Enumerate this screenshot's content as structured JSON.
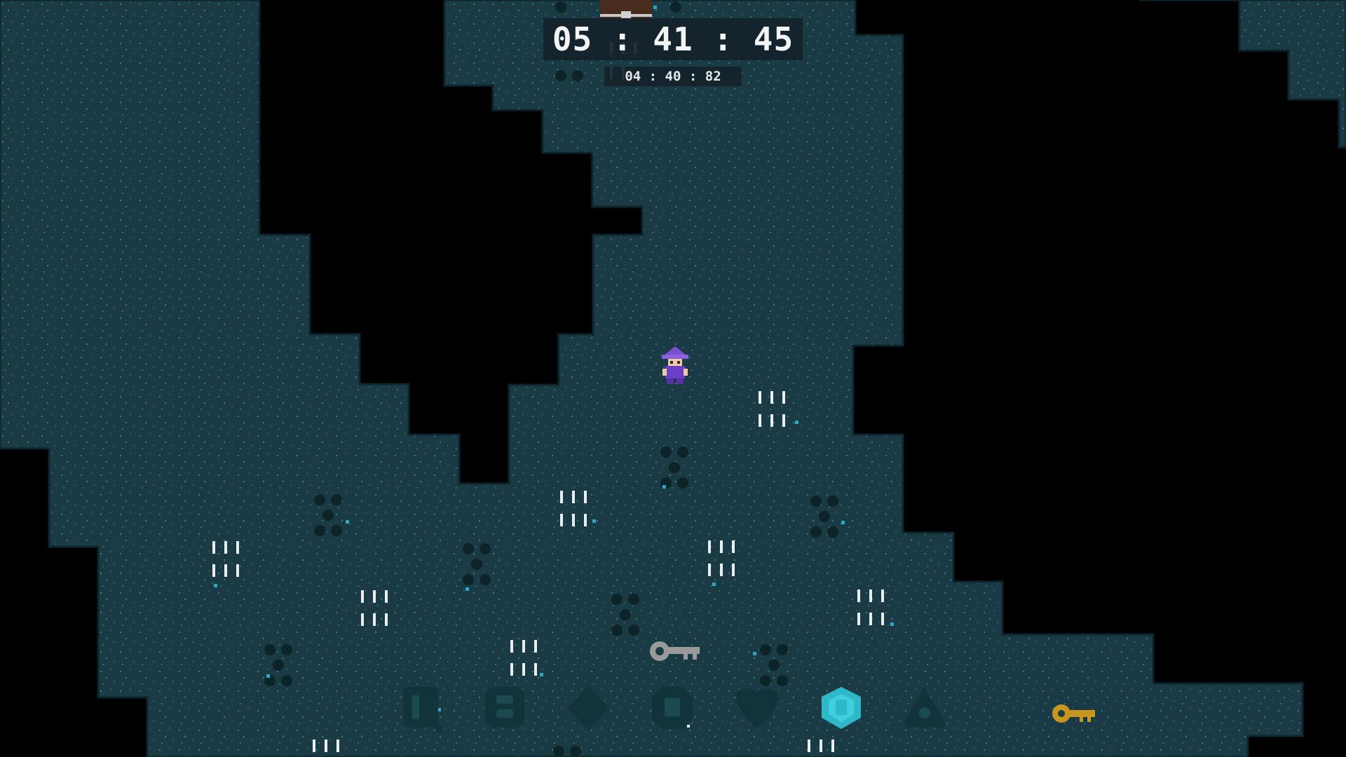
{
  "hud": {
    "current_time": "05 : 41 : 45",
    "best_time": "04 : 40 : 82"
  },
  "colors": {
    "void": "#000000",
    "floor": "#1a3a44",
    "floor_speck": "#2f7f8c",
    "player_hat": "#7a4fd0",
    "silver_key": "#9a9a9a",
    "gold_key": "#c8961e",
    "active_gem": "#2fb8c8",
    "inactive_gem": "#10343a"
  },
  "entities": {
    "player": "wizard-player",
    "chest": "treasure-chest",
    "keys": [
      "silver-key",
      "gold-key"
    ]
  },
  "inventory": {
    "slots": [
      {
        "name": "rune-d",
        "active": false
      },
      {
        "name": "rune-b",
        "active": false
      },
      {
        "name": "rune-diamond",
        "active": false
      },
      {
        "name": "rune-octagon",
        "active": false
      },
      {
        "name": "rune-heart",
        "active": false
      },
      {
        "name": "rune-hexagon",
        "active": true
      },
      {
        "name": "rune-triangle",
        "active": false
      }
    ]
  }
}
